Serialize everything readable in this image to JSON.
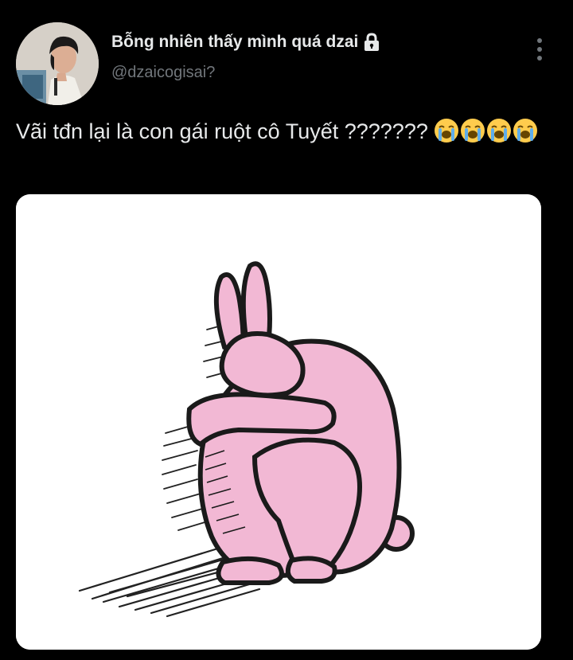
{
  "tweet": {
    "display_name": "Bỗng nhiên thấy mình quá dzai",
    "handle": "@dzaicogisai?",
    "text": "Vãi tđn lại là con gái ruột cô Tuyết ???????",
    "emojis": [
      "loudly-crying-face",
      "loudly-crying-face",
      "loudly-crying-face",
      "loudly-crying-face"
    ],
    "protected_icon": "lock-icon",
    "menu_icon": "more-vertical-icon",
    "media_subject": "pink-rabbit-illustration"
  },
  "colors": {
    "background": "#000000",
    "text_primary": "#e7e9ea",
    "text_secondary": "#71767b",
    "media_background": "#ffffff",
    "rabbit_pink": "#f2b8d4"
  }
}
